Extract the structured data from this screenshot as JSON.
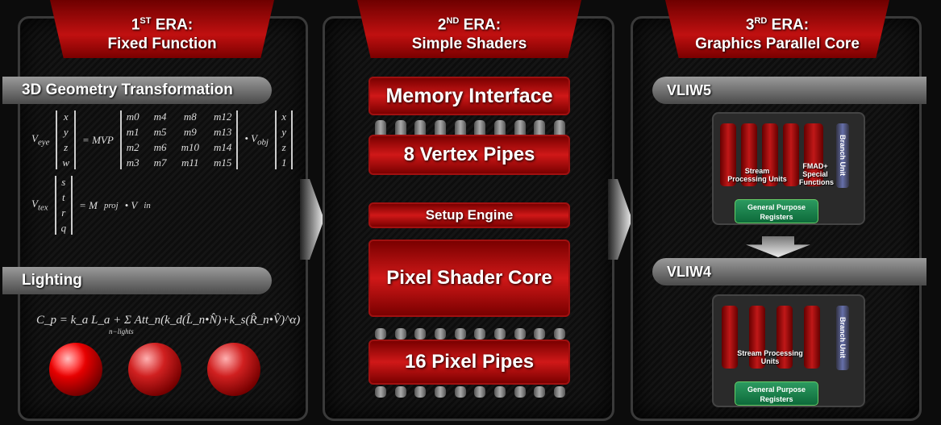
{
  "eras": [
    {
      "ordinal": "1",
      "suffix": "ST",
      "title": "ERA:",
      "subtitle": "Fixed Function"
    },
    {
      "ordinal": "2",
      "suffix": "ND",
      "title": "ERA:",
      "subtitle": "Simple Shaders"
    },
    {
      "ordinal": "3",
      "suffix": "RD",
      "title": "ERA:",
      "subtitle": "Graphics Parallel Core"
    }
  ],
  "era1": {
    "section1": "3D Geometry Transformation",
    "section2": "Lighting",
    "eq1": {
      "lhs": "V",
      "lhs_sub": "eye",
      "vec": [
        "x",
        "y",
        "z",
        "w"
      ],
      "op": "= MVP",
      "matrix": [
        "m0",
        "m4",
        "m8",
        "m12",
        "m1",
        "m5",
        "m9",
        "m13",
        "m2",
        "m6",
        "m10",
        "m14",
        "m3",
        "m7",
        "m11",
        "m15"
      ],
      "dot": "• V",
      "rhs_sub": "obj",
      "vec2": [
        "x",
        "y",
        "z",
        "1"
      ]
    },
    "eq2": {
      "lhs": "V",
      "lhs_sub": "tex",
      "vec": [
        "s",
        "t",
        "r",
        "q"
      ],
      "op": "= M",
      "op_sub": "proj",
      "rhs": "• V",
      "rhs_sub": "in"
    },
    "eq3": {
      "text": "C_p = k_a L_a + Σ Att_n(k_d(L̂_n•N̂)+k_s(R̂_n•V̂)^α)",
      "sum_sub": "n−lights"
    }
  },
  "era2": {
    "blocks": [
      "Memory Interface",
      "8 Vertex Pipes",
      "Setup Engine",
      "Pixel Shader Core",
      "16 Pixel Pipes"
    ]
  },
  "era3": {
    "vliw5": {
      "title": "VLIW5",
      "spu": "Stream Processing Units",
      "special": "FMAD+ Special Functions",
      "branch": "Branch Unit",
      "gpr": "General Purpose Registers"
    },
    "vliw4": {
      "title": "VLIW4",
      "spu": "Stream Processing Units",
      "branch": "Branch Unit",
      "gpr": "General Purpose Registers"
    }
  },
  "colors": {
    "accent": "#c01010",
    "gpr": "#1a8a4e",
    "branch": "#5a64a0"
  }
}
